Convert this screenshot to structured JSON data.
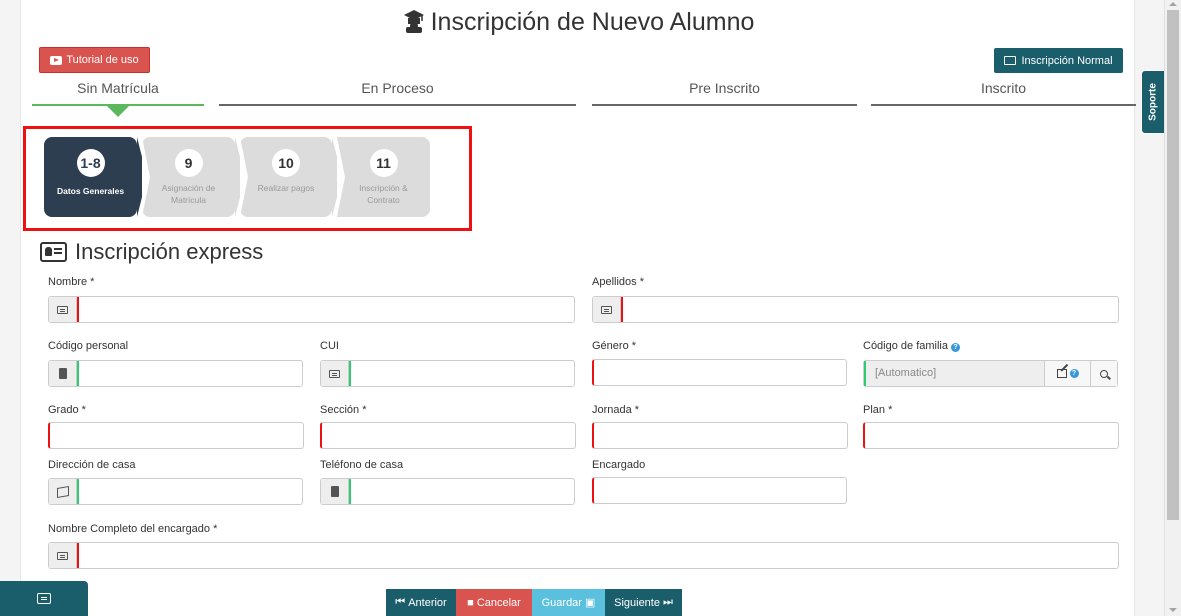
{
  "header": {
    "title": "Inscripción de Nuevo Alumno",
    "tutorial_label": "Tutorial de uso",
    "normal_label": "Inscripción Normal"
  },
  "stages": [
    {
      "label": "Sin Matrícula",
      "active": true
    },
    {
      "label": "En Proceso",
      "active": false
    },
    {
      "label": "Pre Inscrito",
      "active": false
    },
    {
      "label": "Inscrito",
      "active": false
    }
  ],
  "steps": [
    {
      "num": "1-8",
      "label": "Datos Generales",
      "active": true
    },
    {
      "num": "9",
      "label": "Asignación de Matrícula",
      "active": false
    },
    {
      "num": "10",
      "label": "Realizar pagos",
      "active": false
    },
    {
      "num": "11",
      "label": "Inscripción & Contrato",
      "active": false
    }
  ],
  "section_title": "Inscripción express",
  "form": {
    "nombre": "Nombre *",
    "apellidos": "Apellidos *",
    "codigo_personal": "Código personal",
    "cui": "CUI",
    "genero": "Género *",
    "codigo_familia": "Código de familia",
    "codigo_familia_value": "[Automatico]",
    "grado": "Grado *",
    "seccion": "Sección *",
    "jornada": "Jornada *",
    "plan": "Plan *",
    "direccion": "Dirección de casa",
    "telefono": "Teléfono de casa",
    "encargado": "Encargado",
    "nombre_encargado": "Nombre Completo del encargado *"
  },
  "footer": {
    "anterior": "Anterior",
    "cancelar": "Cancelar",
    "guardar": "Guardar",
    "siguiente": "Siguiente"
  },
  "sidebar": {
    "soporte": "Soporte"
  },
  "colors": {
    "teal": "#1b5e6b",
    "danger": "#d9534f",
    "success": "#5cb85c",
    "info": "#5bc0de",
    "step_active": "#2c3e50"
  }
}
